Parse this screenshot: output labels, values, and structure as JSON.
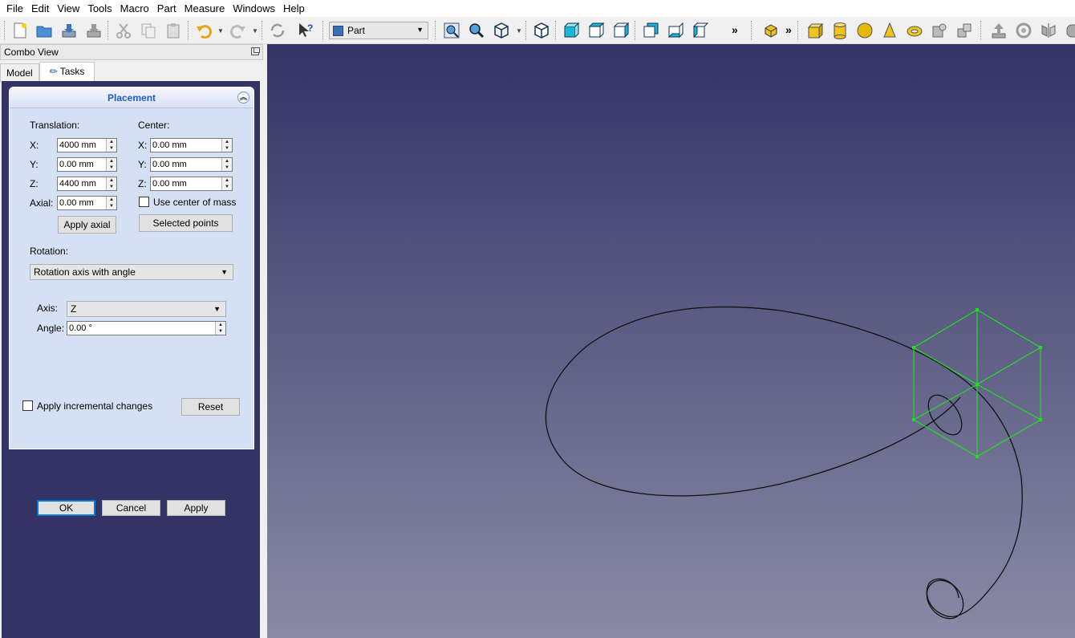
{
  "menu": [
    "File",
    "Edit",
    "View",
    "Tools",
    "Macro",
    "Part",
    "Measure",
    "Windows",
    "Help"
  ],
  "toolbar": {
    "workbench": "Part",
    "overflow_glyph": "»"
  },
  "combo_view": {
    "title": "Combo View",
    "tabs": [
      "Model",
      "Tasks"
    ]
  },
  "placement": {
    "title": "Placement",
    "translation": {
      "label": "Translation:",
      "x_label": "X:",
      "x": "4000 mm",
      "y_label": "Y:",
      "y": "0.00 mm",
      "z_label": "Z:",
      "z": "4400 mm",
      "axial_label": "Axial:",
      "axial": "0.00 mm",
      "apply_axial": "Apply axial"
    },
    "center": {
      "label": "Center:",
      "x_label": "X:",
      "x": "0.00 mm",
      "y_label": "Y:",
      "y": "0.00 mm",
      "z_label": "Z:",
      "z": "0.00 mm",
      "use_center_of_mass": "Use center of mass",
      "selected_points": "Selected points"
    },
    "rotation": {
      "label": "Rotation:",
      "mode": "Rotation axis with angle",
      "axis_label": "Axis:",
      "axis": "Z",
      "angle_label": "Angle:",
      "angle": "0.00 °"
    },
    "apply_incremental": "Apply incremental changes",
    "reset": "Reset"
  },
  "dialog_buttons": {
    "ok": "OK",
    "cancel": "Cancel",
    "apply": "Apply"
  },
  "colors": {
    "view_top": "#333366",
    "view_bottom": "#8a8aa6",
    "selection_green": "#22dd22",
    "panel_title": "#215dc6"
  }
}
